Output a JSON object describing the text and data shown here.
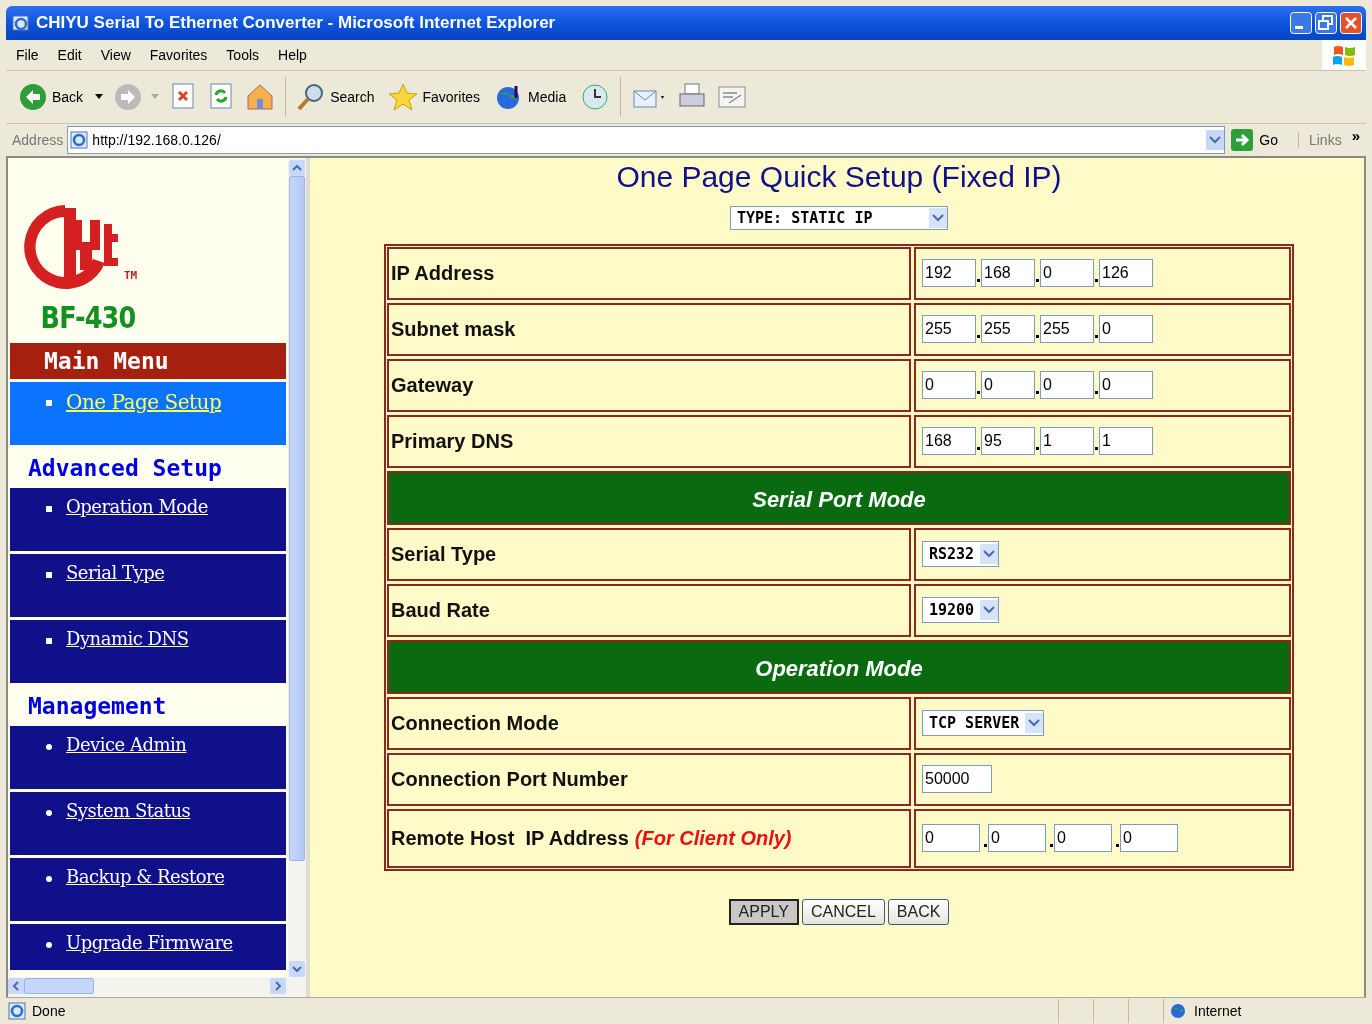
{
  "window": {
    "title": "CHIYU Serial To Ethernet Converter - Microsoft Internet Explorer"
  },
  "menu_bar": [
    "File",
    "Edit",
    "View",
    "Favorites",
    "Tools",
    "Help"
  ],
  "toolbar": [
    {
      "kind": "back",
      "label": "Back"
    },
    {
      "kind": "forward"
    },
    {
      "kind": "stop"
    },
    {
      "kind": "refresh"
    },
    {
      "kind": "home"
    },
    {
      "kind": "search",
      "label": "Search"
    },
    {
      "kind": "favorites",
      "label": "Favorites"
    },
    {
      "kind": "media",
      "label": "Media"
    },
    {
      "kind": "history"
    },
    {
      "kind": "mail"
    },
    {
      "kind": "print"
    },
    {
      "kind": "edit"
    }
  ],
  "address_bar": {
    "label": "Address",
    "value": "http://192.168.0.126/",
    "go": "Go",
    "links": "Links",
    "more": "»"
  },
  "sidebar": {
    "trademark": "TM",
    "model": "BF-430",
    "sections": [
      {
        "title": "Main Menu",
        "kind": "main",
        "round_bullets": false,
        "items": [
          {
            "label": "One Page Setup",
            "selected": true
          }
        ]
      },
      {
        "title": "Advanced Setup",
        "kind": "plain",
        "round_bullets": false,
        "items": [
          {
            "label": "Operation Mode",
            "selected": false
          },
          {
            "label": "Serial Type",
            "selected": false
          },
          {
            "label": "Dynamic DNS",
            "selected": false
          }
        ]
      },
      {
        "title": "Management",
        "kind": "plain",
        "round_bullets": true,
        "items": [
          {
            "label": "Device Admin",
            "selected": false
          },
          {
            "label": "System Status",
            "selected": false
          },
          {
            "label": "Backup & Restore",
            "selected": false
          },
          {
            "label": "Upgrade Firmware",
            "selected": false
          }
        ]
      }
    ]
  },
  "page": {
    "title": "One Page Quick Setup (Fixed IP)",
    "type_select": "TYPE: STATIC IP",
    "rows": [
      {
        "kind": "ip",
        "label": "IP Address",
        "octets": [
          "192",
          "168",
          "0",
          "126"
        ]
      },
      {
        "kind": "ip",
        "label": "Subnet mask",
        "octets": [
          "255",
          "255",
          "255",
          "0"
        ]
      },
      {
        "kind": "ip",
        "label": "Gateway",
        "octets": [
          "0",
          "0",
          "0",
          "0"
        ]
      },
      {
        "kind": "ip",
        "label": "Primary DNS",
        "octets": [
          "168",
          "95",
          "1",
          "1"
        ]
      },
      {
        "kind": "header",
        "label": "Serial Port Mode"
      },
      {
        "kind": "select",
        "label": "Serial Type",
        "value": "RS232"
      },
      {
        "kind": "select",
        "label": "Baud Rate",
        "value": "19200"
      },
      {
        "kind": "header",
        "label": "Operation Mode"
      },
      {
        "kind": "select",
        "label": "Connection Mode",
        "value": "TCP SERVER"
      },
      {
        "kind": "text",
        "label": "Connection Port Number",
        "value": "50000"
      },
      {
        "kind": "ip",
        "label": "Remote Host  IP Address",
        "note": "(For Client Only)",
        "octets": [
          "0",
          "0",
          "0",
          "0"
        ]
      }
    ],
    "buttons": [
      {
        "label": "APPLY",
        "pressed": true
      },
      {
        "label": "CANCEL",
        "pressed": false
      },
      {
        "label": "BACK",
        "pressed": false
      }
    ]
  },
  "status_bar": {
    "text": "Done",
    "zone": "Internet"
  }
}
